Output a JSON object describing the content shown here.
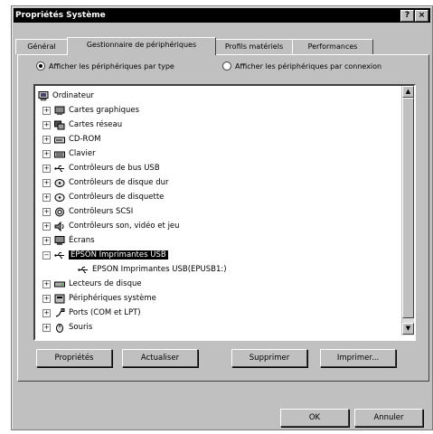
{
  "window": {
    "title": "Propriétés Système",
    "help_btn": "?",
    "close_btn": "×"
  },
  "tabs": [
    {
      "label": "Général"
    },
    {
      "label": "Gestionnaire de périphériques"
    },
    {
      "label": "Profils matériels"
    },
    {
      "label": "Performances"
    }
  ],
  "view_options": {
    "by_type": "Afficher les périphériques par type",
    "by_connection": "Afficher les périphériques par connexion"
  },
  "tree": {
    "root": "Ordinateur",
    "items": [
      {
        "label": "Cartes graphiques",
        "icon": "display-adapter-icon"
      },
      {
        "label": "Cartes réseau",
        "icon": "network-adapter-icon"
      },
      {
        "label": "CD-ROM",
        "icon": "cdrom-icon"
      },
      {
        "label": "Clavier",
        "icon": "keyboard-icon"
      },
      {
        "label": "Contrôleurs de bus USB",
        "icon": "usb-icon"
      },
      {
        "label": "Contrôleurs de disque dur",
        "icon": "disk-controller-icon"
      },
      {
        "label": "Contrôleurs de disquette",
        "icon": "floppy-controller-icon"
      },
      {
        "label": "Contrôleurs SCSI",
        "icon": "scsi-icon"
      },
      {
        "label": "Contrôleurs son, vidéo et jeu",
        "icon": "sound-icon"
      },
      {
        "label": "Écrans",
        "icon": "monitor-icon"
      },
      {
        "label": "EPSON Imprimantes USB",
        "icon": "usb-printer-icon"
      },
      {
        "label": "EPSON Imprimantes USB(EPUSB1:)",
        "icon": "usb-printer-icon"
      },
      {
        "label": "Lecteurs de disque",
        "icon": "disk-drive-icon"
      },
      {
        "label": "Périphériques système",
        "icon": "system-device-icon"
      },
      {
        "label": "Ports (COM et LPT)",
        "icon": "port-icon"
      },
      {
        "label": "Souris",
        "icon": "mouse-icon"
      }
    ]
  },
  "buttons": {
    "properties": "Propriétés",
    "refresh": "Actualiser",
    "remove": "Supprimer",
    "print": "Imprimer...",
    "ok": "OK",
    "cancel": "Annuler"
  },
  "scroll": {
    "up": "▲",
    "down": "▼"
  }
}
